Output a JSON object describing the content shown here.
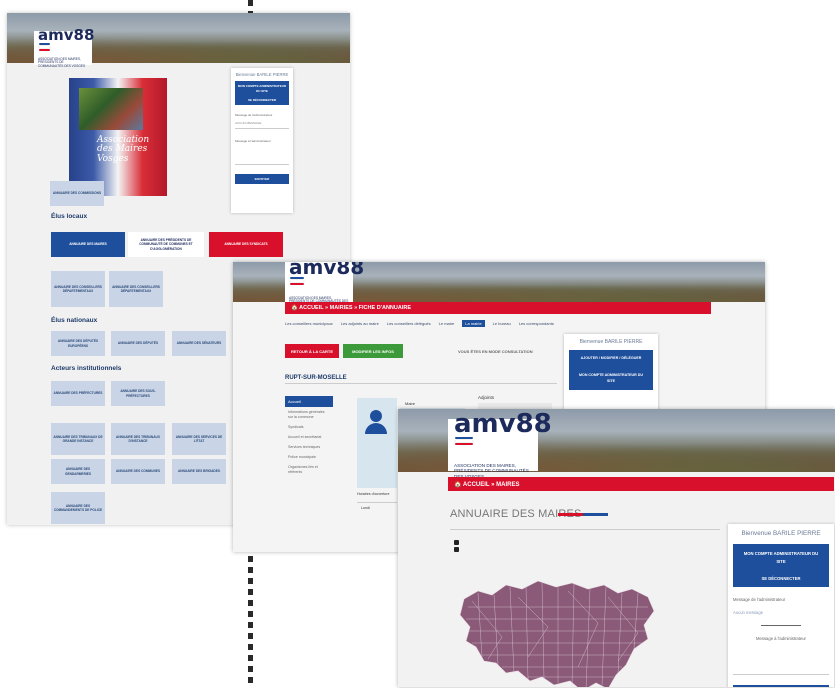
{
  "brand": {
    "logo_word": "amv88",
    "logo_sub": "ASSOCIATION DES MAIRES, PRÉSIDENTS DE COMMUNAUTÉS DES VOSGES",
    "colors": {
      "red": "#d8102c",
      "blue": "#1e4f9c",
      "navy": "#1c2a5c",
      "tile": "#c9d5e6"
    }
  },
  "win1": {
    "poster_title": "Association des Maires Vosges",
    "sidebar": {
      "hello": "Bienvenue BARILE PIERRE",
      "account_btn": "MON COMPTE ADMINISTRATEUR DU SITE",
      "logout_btn": "SE DÉCONNECTER",
      "admin_msg_label": "Message de l'administrateur",
      "admin_msg_value": "AUCUN MESSAGE",
      "to_admin_label": "Message à l'administrateur",
      "send_btn": "ENVOYER"
    },
    "tile_top": "ANNUAIRE DES COMMISSIONS",
    "sections": {
      "elus_locaux": "Élus locaux",
      "elus_nationaux": "Élus nationaux",
      "acteurs": "Acteurs institutionnels"
    },
    "row_locaux": [
      "ANNUAIRE DES MAIRES",
      "ANNUAIRE DES PRÉSIDENTS DE COMMUNAUTÉ DE COMMUNES ET D'AGGLOMÉRATION",
      "ANNUAIRE DES SYNDICATS"
    ],
    "row_conseillers": [
      "ANNUAIRE DES CONSEILLERS DÉPARTEMENTAUX",
      "ANNUAIRE DES CONSEILLERS DÉPARTEMENTAUX"
    ],
    "row_nationaux": [
      "ANNUAIRE DES DÉPUTÉS EUROPÉENS",
      "ANNUAIRE DES DÉPUTÉS",
      "ANNUAIRE DES SÉNATEURS"
    ],
    "row_pref": [
      "ANNUAIRE DES PRÉFECTURES",
      "ANNUAIRE DES SOUS-PRÉFECTURES"
    ],
    "row_trib": [
      "ANNUAIRE DES TRIBUNAUX DE GRANDE INSTANCE",
      "ANNUAIRE DES TRIBUNAUX D'INSTANCE",
      "ANNUAIRE DES SERVICES DE L'ÉTAT"
    ],
    "row_gend": [
      "ANNUAIRE DES GENDARMERIES",
      "ANNUAIRE DES COMMUNES",
      "ANNUAIRE DES BRIGADES"
    ],
    "tile_last": "ANNUAIRE DES COMMANDEMENTS DE POLICE"
  },
  "win2": {
    "breadcrumb": "🏠 ACCUEIL » MAIRIES » FICHE D'ANNUAIRE",
    "tabs": [
      "Les conseillers municipaux",
      "Les adjoints au maire",
      "Les conseillers délégués",
      "Le maire",
      "La mairie",
      "Le bureau",
      "Les correspondants"
    ],
    "active_tab": "La mairie",
    "back_btn": "RETOUR À LA CARTE",
    "edit_btn": "MODIFIER LES INFOS",
    "mode_text": "VOUS ÊTES EN MODE CONSULTATION",
    "commune": "RUPT-SUR-MOSELLE",
    "side_menu": [
      "Accueil",
      "Informations générales sur la commune",
      "Syndicats",
      "Accueil et secrétariat",
      "Services techniques",
      "Police municipale",
      "Organismes liés et référents"
    ],
    "maire_label": "Maire",
    "adjoints_label": "Adjoints",
    "horaires_label": "Horaires d'ouverture",
    "horaires_day": "Lundi",
    "sidebar": {
      "hello": "Bienvenue BARILE PIERRE",
      "edit_btn": "AJOUTER / MODIFIER / DÉLÉGUER",
      "account_btn": "MON COMPTE ADMINISTRATEUR DU SITE"
    }
  },
  "win3": {
    "breadcrumb": "🏠 ACCUEIL » MAIRES",
    "page_title": "ANNUAIRE DES MAIRES",
    "sidebar": {
      "hello": "Bienvenue BARILE PIERRE",
      "account_btn": "MON COMPTE ADMINISTRATEUR DU SITE",
      "logout_btn": "SE DÉCONNECTER",
      "admin_msg_label": "Message de l'administrateur",
      "admin_msg_value": "Aucun message",
      "to_admin_label": "Message à l'administrateur"
    },
    "map_color": "#8a5a78"
  }
}
